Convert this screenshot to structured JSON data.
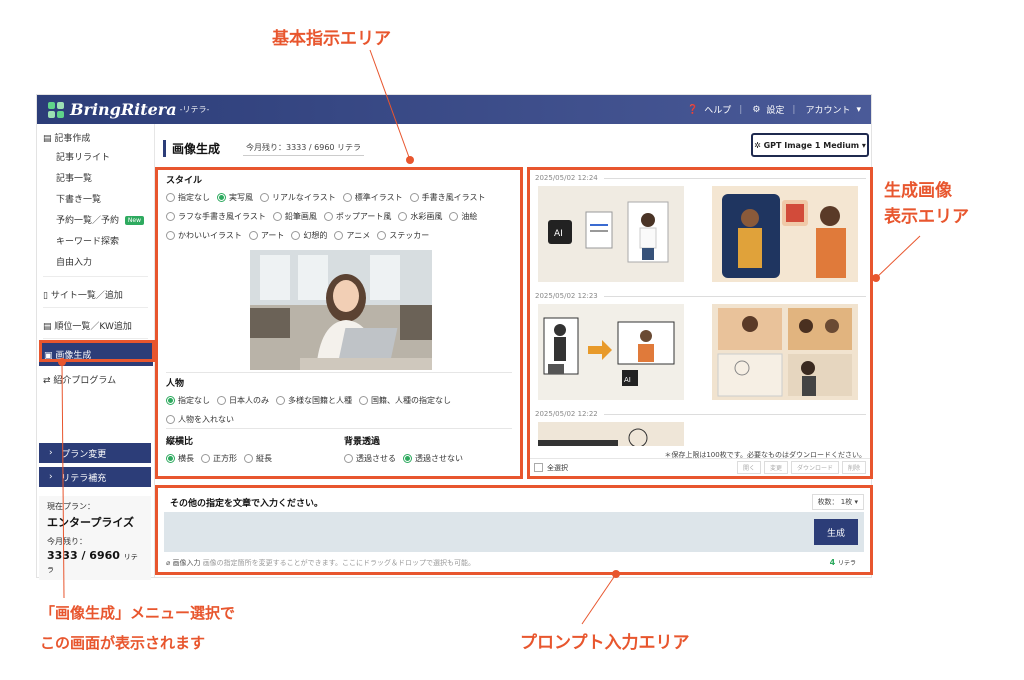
{
  "callouts": {
    "basic": "基本指示エリア",
    "gen_line1": "生成画像",
    "gen_line2": "表示エリア",
    "menu_line1": "「画像生成」メニュー選択で",
    "menu_line2": "この画面が表示されます",
    "prompt": "プロンプト入力エリア",
    "color": "#e8562e"
  },
  "app": {
    "logo": "BringRitera",
    "logo_sub": "-リテラ-",
    "help": "ヘルプ",
    "settings": "設定",
    "account": "アカウント"
  },
  "sidebar": {
    "group_article": "記事作成",
    "items": [
      "記事リライト",
      "記事一覧",
      "下書き一覧",
      "予約一覧／予約",
      "キーワード探索",
      "自由入力"
    ],
    "new_badge": "New",
    "site": "サイト一覧／追加",
    "rank": "順位一覧／KW追加",
    "image_gen": "画像生成",
    "referral": "紹介プログラム",
    "plan_change": "プラン変更",
    "ritera_add": "リテラ補充",
    "plan_label": "現在プラン：",
    "plan_value": "エンタープライズ",
    "remain_label": "今月残り：",
    "remain_value": "3333 / 6960",
    "remain_unit": "リテラ"
  },
  "main": {
    "title": "画像生成",
    "remain": "今月残り：3333 / 6960 リテラ",
    "model": "GPT Image 1 Medium"
  },
  "style": {
    "title": "スタイル",
    "row1": [
      "指定なし",
      "実写風",
      "リアルなイラスト",
      "標準イラスト",
      "手書き風イラスト"
    ],
    "row2": [
      "ラフな手書き風イラスト",
      "鉛筆画風",
      "ポップアート風",
      "水彩画風",
      "油絵"
    ],
    "row3": [
      "かわいいイラスト",
      "アート",
      "幻想的",
      "アニメ",
      "ステッカー"
    ],
    "selected": "実写風"
  },
  "person": {
    "title": "人物",
    "row1": [
      "指定なし",
      "日本人のみ",
      "多様な国籍と人種",
      "国籍、人種の指定なし"
    ],
    "row2": [
      "人物を入れない"
    ],
    "selected": "指定なし"
  },
  "ratio": {
    "title": "縦横比",
    "options": [
      "横長",
      "正方形",
      "縦長"
    ],
    "selected": "横長"
  },
  "bg": {
    "title": "背景透過",
    "options": [
      "透過させる",
      "透過させない"
    ],
    "selected": "透過させない"
  },
  "gallery": {
    "date1": "2025/05/02 12:24",
    "date2": "2025/05/02 12:23",
    "date3": "2025/05/02 12:22",
    "save_note": "＊保存上限は100枚です。必要なものはダウンロードください。",
    "select_all": "全選択",
    "btn_open": "開く",
    "btn_edit": "変更",
    "btn_download": "ダウンロード",
    "btn_delete": "削除"
  },
  "prompt": {
    "title": "その他の指定を文章で入力ください。",
    "count": "枚数： 1枚",
    "generate": "生成",
    "image_input": "画像入力",
    "image_input_desc": "画像の指定箇所を変更することができます。ここにドラッグ＆ドロップで選択も可能。",
    "cost": "4",
    "cost_unit": "リテラ"
  }
}
